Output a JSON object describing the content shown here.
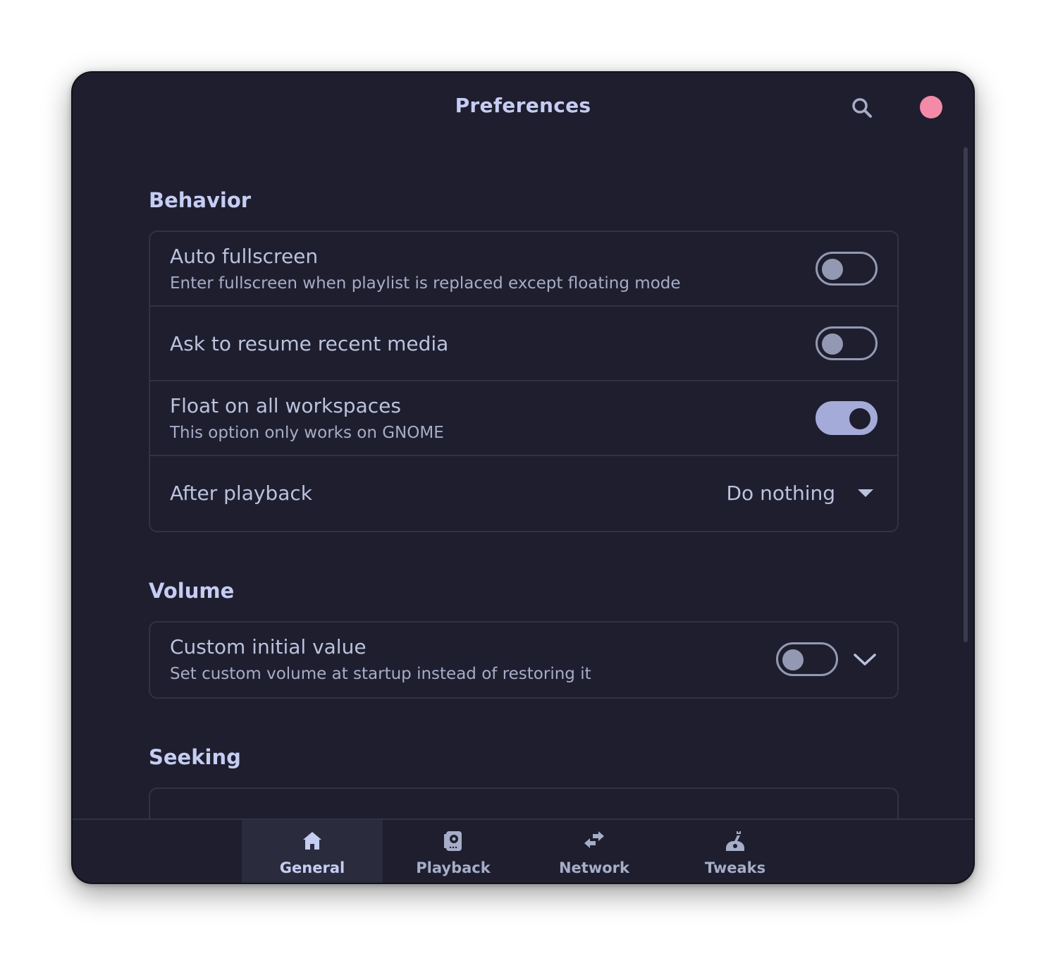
{
  "window": {
    "title": "Preferences"
  },
  "header": {
    "search_icon": "search-icon",
    "close_icon": "close-icon",
    "close_color": "#f38ba8"
  },
  "sections": {
    "behavior": {
      "title": "Behavior",
      "auto_fullscreen": {
        "title": "Auto fullscreen",
        "subtitle": "Enter fullscreen when playlist is replaced except floating mode",
        "enabled": false
      },
      "resume": {
        "title": "Ask to resume recent media",
        "enabled": false
      },
      "float": {
        "title": "Float on all workspaces",
        "subtitle": "This option only works on GNOME",
        "enabled": true
      },
      "after_playback": {
        "title": "After playback",
        "value": "Do nothing"
      }
    },
    "volume": {
      "title": "Volume",
      "custom_initial": {
        "title": "Custom initial value",
        "subtitle": "Set custom volume at startup instead of restoring it",
        "enabled": false
      }
    },
    "seeking": {
      "title": "Seeking"
    }
  },
  "tabs": [
    {
      "label": "General",
      "icon": "home-icon",
      "active": true
    },
    {
      "label": "Playback",
      "icon": "speaker-icon",
      "active": false
    },
    {
      "label": "Network",
      "icon": "network-arrows-icon",
      "active": false
    },
    {
      "label": "Tweaks",
      "icon": "wrench-icon",
      "active": false
    }
  ],
  "colors": {
    "background": "#1e1e2e",
    "accent": "#a4abd9",
    "text": "#c6cdf3",
    "border": "#313244"
  }
}
